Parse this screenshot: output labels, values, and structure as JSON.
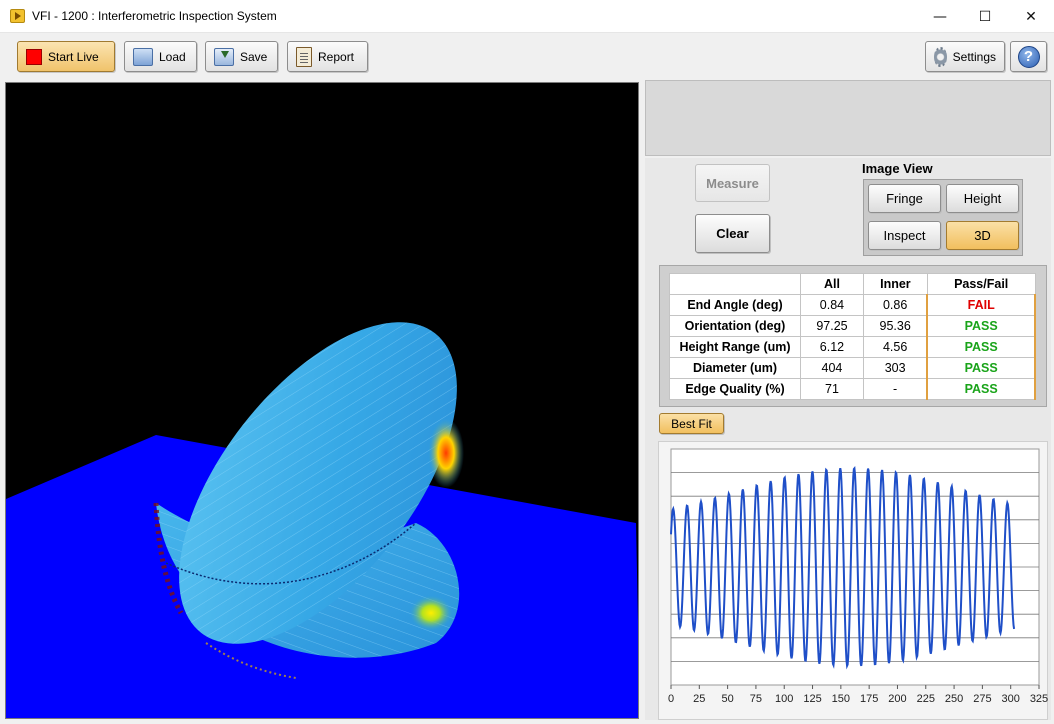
{
  "window": {
    "title": "VFI - 1200 : Interferometric Inspection System",
    "minimize": "—",
    "maximize": "☐",
    "close": "✕"
  },
  "toolbar": {
    "start_live": "Start Live",
    "load": "Load",
    "save": "Save",
    "report": "Report",
    "settings": "Settings",
    "help": "?"
  },
  "controls": {
    "measure": "Measure",
    "clear": "Clear",
    "image_view_label": "Image View",
    "views": [
      "Fringe",
      "Height",
      "Inspect",
      "3D"
    ],
    "selected_view": "3D"
  },
  "results": {
    "columns": [
      "",
      "All",
      "Inner",
      "Pass/Fail"
    ],
    "rows": [
      {
        "label": "End Angle (deg)",
        "all": "0.84",
        "inner": "0.86",
        "status": "FAIL"
      },
      {
        "label": "Orientation (deg)",
        "all": "97.25",
        "inner": "95.36",
        "status": "PASS"
      },
      {
        "label": "Height Range (um)",
        "all": "6.12",
        "inner": "4.56",
        "status": "PASS"
      },
      {
        "label": "Diameter (um)",
        "all": "404",
        "inner": "303",
        "status": "PASS"
      },
      {
        "label": "Edge Quality (%)",
        "all": "71",
        "inner": "-",
        "status": "PASS"
      }
    ],
    "colors": {
      "fail": "#e00000",
      "pass": "#1aa41a"
    }
  },
  "best_fit": "Best Fit",
  "chart_data": {
    "type": "line",
    "x_ticks": [
      "0",
      "25",
      "50",
      "75",
      "100",
      "125",
      "150",
      "175",
      "200",
      "225",
      "250",
      "275",
      "300",
      "325"
    ],
    "xlim": [
      0,
      325
    ],
    "ylim": [
      0,
      1
    ],
    "grid": true,
    "line_color": "#1f4fc8",
    "period": 12.3,
    "envelope": {
      "min_amp": 0.18,
      "max_amp": 0.42,
      "center_x": 160,
      "width": 140
    },
    "x_end": 303
  }
}
